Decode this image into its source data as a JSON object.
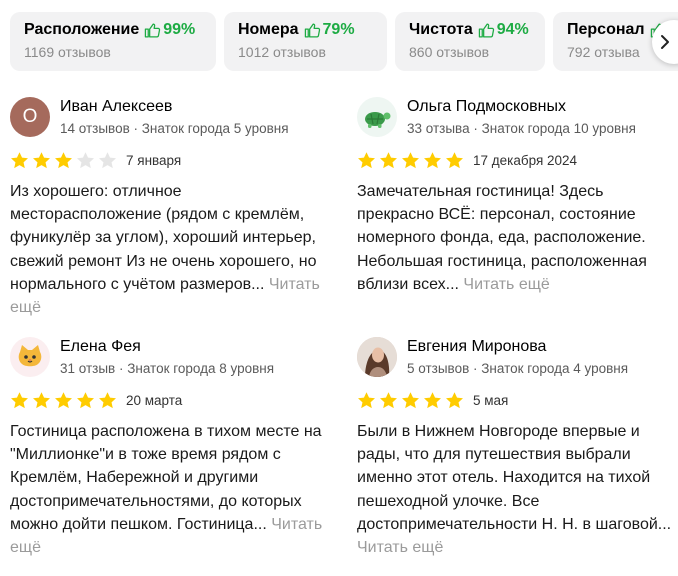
{
  "categories": [
    {
      "name": "Расположение",
      "pct": "99%",
      "count": "1169 отзывов"
    },
    {
      "name": "Номера",
      "pct": "79%",
      "count": "1012 отзывов"
    },
    {
      "name": "Чистота",
      "pct": "94%",
      "count": "860 отзывов"
    },
    {
      "name": "Персонал",
      "pct": "",
      "count": "792 отзыва"
    }
  ],
  "next_icon": "chevron-right-icon",
  "colors": {
    "positive": "#1dab43",
    "star": "#ffcc00",
    "star_empty": "#e5e5e5",
    "muted": "#9b9b9b"
  },
  "reviews": [
    {
      "avatar_letter": "О",
      "author": "Иван Алексеев",
      "meta": "14 отзывов · Знаток города 5 уровня",
      "rating": 3,
      "date": "7 января",
      "text": "Из хорошего: отличное месторасположение (рядом с кремлём, фуникулёр за углом), хороший интерьер, свежий ремонт Из не очень хорошего, но нормального с учётом размеров...",
      "more": "Читать ещё"
    },
    {
      "avatar_icon": "turtle-avatar-icon",
      "author": "Ольга Подмосковных",
      "meta": "33 отзыва · Знаток города 10 уровня",
      "rating": 5,
      "date": "17 декабря 2024",
      "text": "Замечательная гостиница! Здесь прекрасно ВСЁ: персонал, состояние номерного фонда, еда, расположение. Небольшая гостиница, расположенная вблизи всех...",
      "more": "Читать ещё"
    },
    {
      "avatar_icon": "cat-avatar-icon",
      "author": "Елена Фея",
      "meta": "31 отзыв · Знаток города 8 уровня",
      "rating": 5,
      "date": "20 марта",
      "text": "Гостиница расположена в тихом месте на \"Миллионке\"и в тоже время рядом с Кремлём, Набережной и другими достопримечательностями, до которых можно дойти пешком. Гостиница...",
      "more": "Читать ещё"
    },
    {
      "avatar_icon": "photo-avatar-icon",
      "author": "Евгения Миронова",
      "meta": "5 отзывов · Знаток города 4 уровня",
      "rating": 5,
      "date": "5 мая",
      "text": "Были в Нижнем Новгороде впервые и рады, что для путешествия выбрали именно этот отель. Находится на тихой пешеходной улочке. Все достопримечательности Н. Н. в шаговой...",
      "more": "Читать ещё"
    }
  ]
}
